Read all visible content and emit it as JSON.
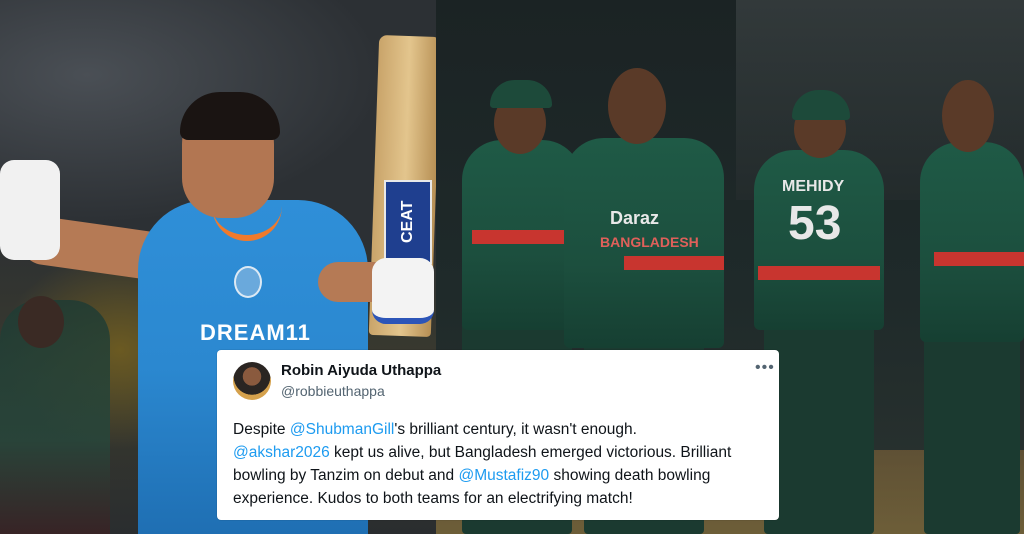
{
  "left_photo": {
    "bat_brand": "CEAT",
    "jersey_text": "DREAM11"
  },
  "right_photo": {
    "jersey_sponsor": "Daraz",
    "jersey_country": "BANGLADESH",
    "player_name_back": "MEHIDY",
    "player_number": "53"
  },
  "tweet": {
    "author_name": "Robin Aiyuda Uthappa",
    "author_handle": "@robbieuthappa",
    "more_icon": "more-horizontal-icon",
    "body": {
      "seg1": "Despite ",
      "mention1": "@ShubmanGill",
      "seg2": "'s brilliant century, it wasn't enough.",
      "mention2": "@akshar2026",
      "seg3": " kept us alive, but Bangladesh emerged victorious. Brilliant bowling by Tanzim on debut and ",
      "mention3": "@Mustafiz90",
      "seg4": " showing death bowling experience. Kudos to both teams for an electrifying match!"
    }
  },
  "colors": {
    "mention": "#1d9bf0",
    "text": "#0f1419",
    "secondary": "#536471",
    "india_jersey": "#2b88d0",
    "bangladesh_jersey": "#1c4f3e",
    "bangladesh_red": "#c8352f"
  }
}
